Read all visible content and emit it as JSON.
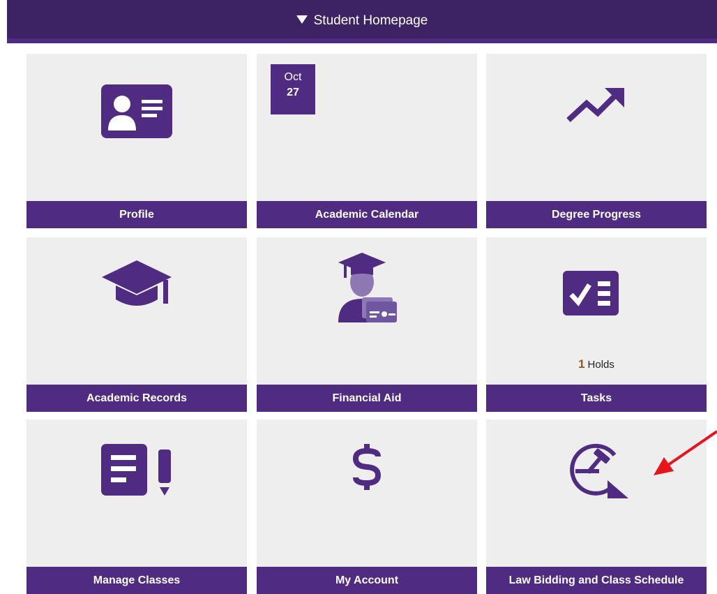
{
  "header": {
    "title": "Student Homepage"
  },
  "tiles": [
    {
      "label": "Profile",
      "icon": "profile-id-card-icon"
    },
    {
      "label": "Academic Calendar",
      "icon": "calendar-icon",
      "calendar": {
        "month": "Oct",
        "day": "27"
      }
    },
    {
      "label": "Degree Progress",
      "icon": "trend-up-arrow-icon"
    },
    {
      "label": "Academic Records",
      "icon": "graduation-cap-icon"
    },
    {
      "label": "Financial Aid",
      "icon": "graduate-with-cards-icon"
    },
    {
      "label": "Tasks",
      "icon": "checklist-icon",
      "badge": {
        "count": "1",
        "text": "Holds"
      }
    },
    {
      "label": "Manage Classes",
      "icon": "document-pencil-icon"
    },
    {
      "label": "My Account",
      "icon": "dollar-sign-icon"
    },
    {
      "label": "Law Bidding and Class Schedule",
      "icon": "gavel-cycle-icon"
    }
  ],
  "colors": {
    "accent": "#4f2c82",
    "header": "#3e2364",
    "tile_bg": "#efeeef",
    "annotation_arrow": "#e8141b"
  }
}
